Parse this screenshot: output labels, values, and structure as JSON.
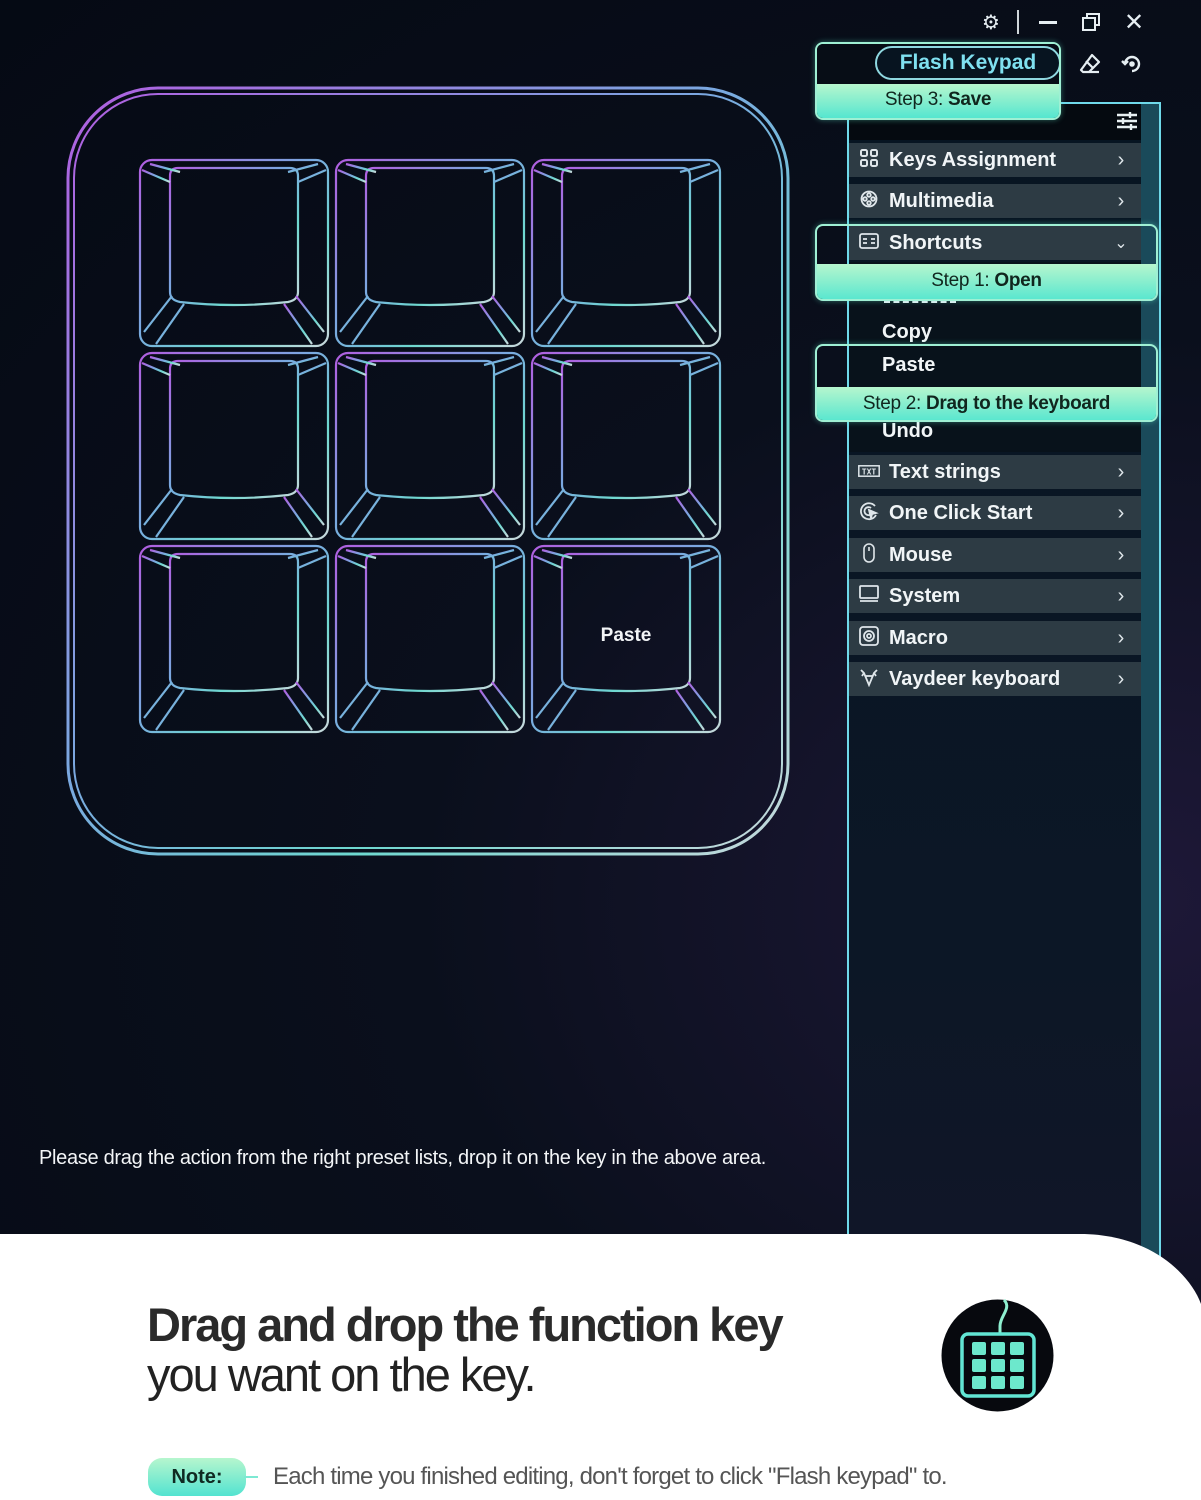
{
  "window_controls": {
    "settings_icon": "gear-icon",
    "minimize_icon": "minimize-icon",
    "restore_icon": "restore-icon",
    "close_icon": "close-icon"
  },
  "toolbar": {
    "flash_label": "Flash Keypad",
    "eraser_icon": "eraser-icon",
    "reset_icon": "reset-icon"
  },
  "callouts": {
    "step3": {
      "prefix": "Step 3: ",
      "action": "Save"
    },
    "step1": {
      "prefix": "Step 1: ",
      "action": "Open"
    },
    "step2": {
      "prefix": "Step 2: ",
      "action": "Drag  to the keyboard"
    }
  },
  "panel": {
    "filter_icon": "sliders-icon",
    "menu": [
      {
        "label": "Keys Assignment",
        "icon": "grid-icon",
        "expanded": false
      },
      {
        "label": "Multimedia",
        "icon": "film-reel-icon",
        "expanded": false
      },
      {
        "label": "Shortcuts",
        "icon": "keyboard-card-icon",
        "expanded": true
      },
      {
        "label": "Text strings",
        "icon": "txt-icon",
        "expanded": false
      },
      {
        "label": "One Click Start",
        "icon": "click-start-icon",
        "expanded": false
      },
      {
        "label": "Mouse",
        "icon": "mouse-icon",
        "expanded": false
      },
      {
        "label": "System",
        "icon": "monitor-icon",
        "expanded": false
      },
      {
        "label": "Macro",
        "icon": "macro-icon",
        "expanded": false
      },
      {
        "label": "Vaydeer keyboard",
        "icon": "vaydeer-logo-icon",
        "expanded": false
      }
    ],
    "shortcuts_sub": [
      "Copy",
      "Paste",
      "Undo"
    ]
  },
  "keypad": {
    "rows": 3,
    "cols": 3,
    "keys": [
      "",
      "",
      "",
      "",
      "",
      "",
      "",
      "",
      "Paste"
    ],
    "gradient_start": "#b05ee0",
    "gradient_end": "#6ed8d0"
  },
  "hint_text": "Please drag the action from the right preset lists, drop it on the key in the above area.",
  "promo": {
    "headline_bold": "Drag and drop the function key",
    "headline_light": "you want on the key.",
    "note_label": "Note:",
    "note_text": "Each time you finished editing, don't forget to click \"Flash keypad\" to."
  },
  "colors": {
    "accent": "#55e6cf",
    "accent_light": "#b6f6ce",
    "panel_border": "#6fd9ea",
    "menu_bg": "#2d3b44"
  }
}
